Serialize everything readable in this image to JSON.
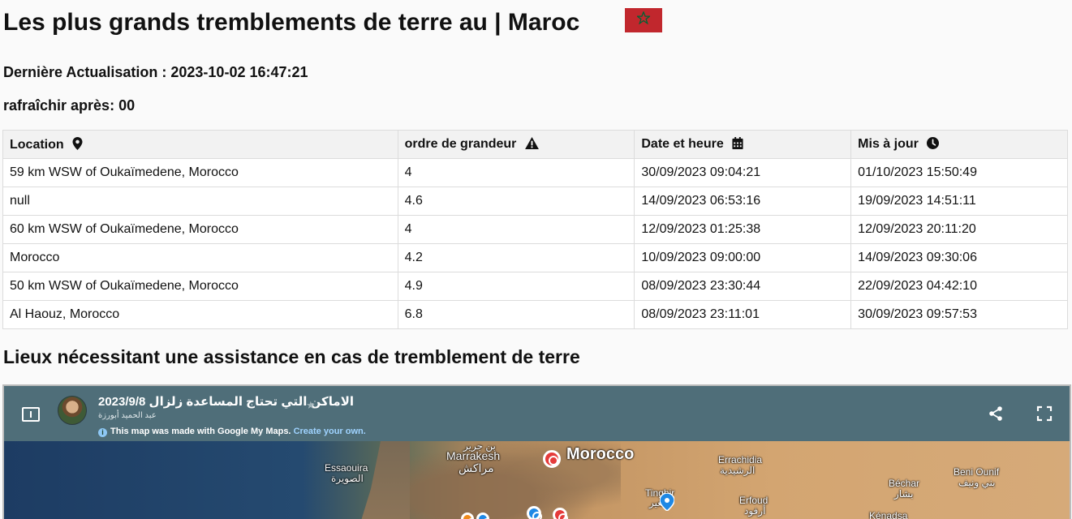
{
  "header": {
    "title": "Les plus grands tremblements de terre au | Maroc",
    "last_update": "Dernière Actualisation : 2023-10-02 16:47:21",
    "refresh": "rafraîchir après: 00"
  },
  "colors": {
    "flag_red": "#c1272d",
    "flag_star": "#006233",
    "map_bar": "#4f6e79"
  },
  "table": {
    "headers": [
      {
        "label": "Location",
        "icon": "map-pin-icon"
      },
      {
        "label": "ordre de grandeur",
        "icon": "warning-icon"
      },
      {
        "label": "Date et heure",
        "icon": "calendar-icon"
      },
      {
        "label": "Mis à jour",
        "icon": "clock-icon"
      }
    ],
    "rows": [
      {
        "location": "59 km WSW of Oukaïmedene, Morocco",
        "magnitude": "4",
        "datetime": "30/09/2023 09:04:21",
        "updated": "01/10/2023 15:50:49"
      },
      {
        "location": "null",
        "magnitude": "4.6",
        "datetime": "14/09/2023 06:53:16",
        "updated": "19/09/2023 14:51:11"
      },
      {
        "location": "60 km WSW of Oukaïmedene, Morocco",
        "magnitude": "4",
        "datetime": "12/09/2023 01:25:38",
        "updated": "12/09/2023 20:11:20"
      },
      {
        "location": "Morocco",
        "magnitude": "4.2",
        "datetime": "10/09/2023 09:00:00",
        "updated": "14/09/2023 09:30:06"
      },
      {
        "location": "50 km WSW of Oukaïmedene, Morocco",
        "magnitude": "4.9",
        "datetime": "08/09/2023 23:30:44",
        "updated": "22/09/2023 04:42:10"
      },
      {
        "location": "Al Haouz, Morocco",
        "magnitude": "6.8",
        "datetime": "08/09/2023 23:11:01",
        "updated": "30/09/2023 09:57:53"
      }
    ]
  },
  "section": {
    "title": "Lieux nécessitant une assistance en cas de tremblement de terre"
  },
  "map": {
    "title": "الاماكن التي تحتاج المساعدة زلزال 2023/9/8",
    "author": "عبد الحميد أبورزة",
    "note": "This map made with Google My Maps.",
    "note_prefix": "This map was made with Google My Maps.",
    "note_link": "Create your own.",
    "labels": {
      "ben_guerir": "بن جرير",
      "marrakesh": "Marrakesh",
      "marrakesh_ar": "مراكش",
      "essaouira": "Essaouira",
      "essaouira_ar": "الصويرة",
      "morocco": "Morocco",
      "errachidia": "Errachidia",
      "errachidia_ar": "الرشيدية",
      "tinghir": "Tinghir",
      "tinghir_ar": "تنغير",
      "erfoud": "Erfoud",
      "erfoud_ar": "أرفود",
      "bechar": "Béchar",
      "bechar_ar": "بشار",
      "beni_ounif": "Beni Ounif",
      "beni_ounif_ar": "بني ونيف",
      "kenadsa": "Kénadsa"
    }
  }
}
